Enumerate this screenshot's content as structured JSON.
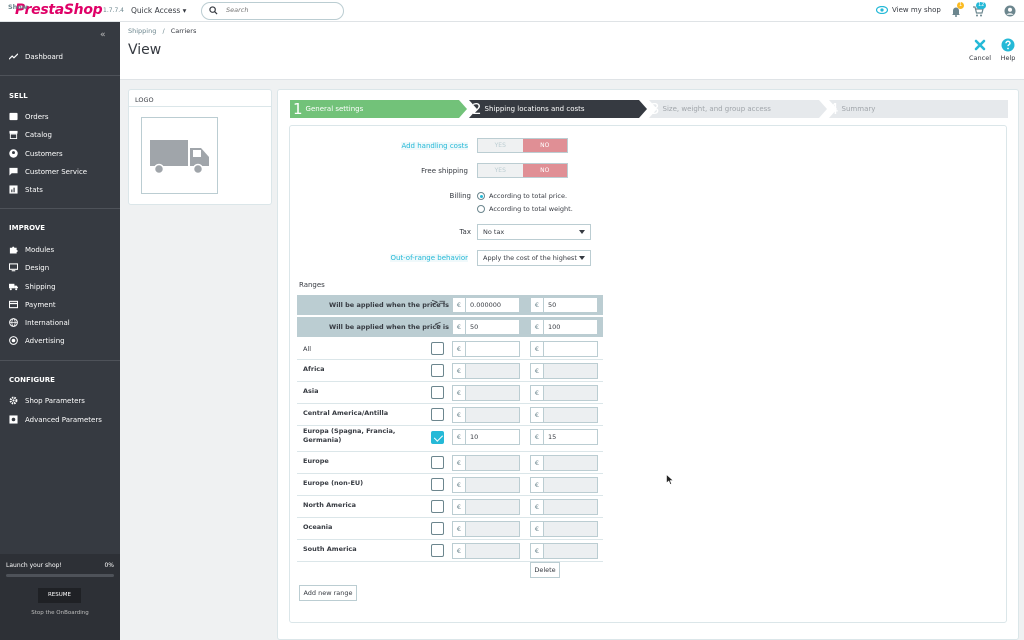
{
  "topbar": {
    "show_tab": "Show",
    "brand": "PrestaShop",
    "version": "1.7.7.4",
    "quick_access": "Quick Access",
    "search_placeholder": "Search",
    "view_shop": "View my shop",
    "notif_count_1": "1",
    "notif_count_2": "12"
  },
  "sidebar": {
    "dashboard": "Dashboard",
    "sell": "SELL",
    "sell_items": [
      "Orders",
      "Catalog",
      "Customers",
      "Customer Service",
      "Stats"
    ],
    "improve": "IMPROVE",
    "improve_items": [
      "Modules",
      "Design",
      "Shipping",
      "Payment",
      "International",
      "Advertising"
    ],
    "configure": "CONFIGURE",
    "configure_items": [
      "Shop Parameters",
      "Advanced Parameters"
    ],
    "onboarding": {
      "title": "Launch your shop!",
      "percent": "0%",
      "resume": "RESUME",
      "stop": "Stop the OnBoarding"
    }
  },
  "header": {
    "breadcrumb_parent": "Shipping",
    "breadcrumb_sep": "/",
    "breadcrumb_current": "Carriers",
    "title": "View",
    "cancel": "Cancel",
    "help": "Help"
  },
  "logo_panel": {
    "title": "LOGO"
  },
  "wizard": [
    {
      "num": "1",
      "label": "General settings"
    },
    {
      "num": "2",
      "label": "Shipping locations and costs"
    },
    {
      "num": "3",
      "label": "Size, weight, and group access"
    },
    {
      "num": "4",
      "label": "Summary"
    }
  ],
  "form": {
    "handling_label": "Add handling costs",
    "free_shipping_label": "Free shipping",
    "yes": "YES",
    "no": "NO",
    "billing_label": "Billing",
    "billing_opt1": "According to total price.",
    "billing_opt2": "According to total weight.",
    "tax_label": "Tax",
    "tax_value": "No tax",
    "oor_label": "Out-of-range behavior",
    "oor_value": "Apply the cost of the highest",
    "ranges_label": "Ranges",
    "range_ge_label": "Will be applied when the price is",
    "range_ge_op": ">=",
    "range_lt_label": "Will be applied when the price is",
    "range_lt_op": "<",
    "currency": "€",
    "range_from": [
      "0.000000",
      "50"
    ],
    "range_to": [
      "50",
      "100"
    ],
    "zones": [
      {
        "name": "All",
        "checked": false,
        "v1": "",
        "v2": ""
      },
      {
        "name": "Africa",
        "checked": false,
        "v1": "",
        "v2": ""
      },
      {
        "name": "Asia",
        "checked": false,
        "v1": "",
        "v2": ""
      },
      {
        "name": "Central America/Antilla",
        "checked": false,
        "v1": "",
        "v2": ""
      },
      {
        "name": "Europa (Spagna, Francia, Germania)",
        "checked": true,
        "v1": "10",
        "v2": "15"
      },
      {
        "name": "Europe",
        "checked": false,
        "v1": "",
        "v2": ""
      },
      {
        "name": "Europe (non-EU)",
        "checked": false,
        "v1": "",
        "v2": ""
      },
      {
        "name": "North America",
        "checked": false,
        "v1": "",
        "v2": ""
      },
      {
        "name": "Oceania",
        "checked": false,
        "v1": "",
        "v2": ""
      },
      {
        "name": "South America",
        "checked": false,
        "v1": "",
        "v2": ""
      }
    ],
    "delete": "Delete",
    "add_range": "Add new range"
  }
}
